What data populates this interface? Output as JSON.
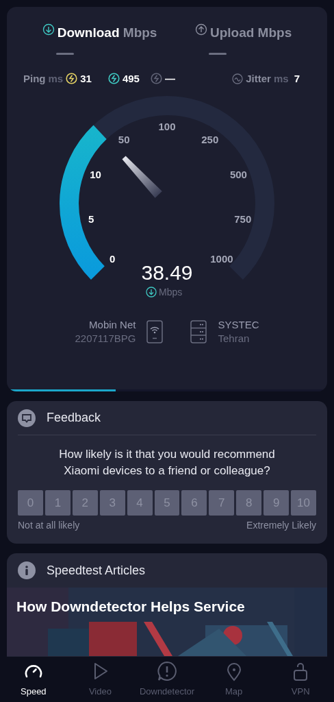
{
  "tabs": [
    {
      "label": "Download",
      "unit": "Mbps",
      "kind": "download",
      "selected": true
    },
    {
      "label": "Upload",
      "unit": "Mbps",
      "kind": "upload",
      "selected": false
    }
  ],
  "ping": {
    "label": "Ping",
    "unit": "ms",
    "readings": [
      {
        "value": "31",
        "color": "#e2d064"
      },
      {
        "value": "495",
        "color": "#3fc8c2"
      },
      {
        "value": "—",
        "color": "#5f6275"
      }
    ]
  },
  "jitter": {
    "label": "Jitter",
    "unit": "ms",
    "value": "7"
  },
  "gauge": {
    "ticks": [
      "0",
      "5",
      "10",
      "50",
      "100",
      "250",
      "500",
      "750",
      "1000"
    ],
    "reading": "38.49",
    "unit": "Mbps"
  },
  "provider": {
    "name": "Mobin Net",
    "detail": "2207117BPG"
  },
  "server": {
    "name": "SYSTEC",
    "detail": "Tehran"
  },
  "progress": {
    "level": 0.34
  },
  "feedback": {
    "title": "Feedback",
    "question": "How likely is it that you would recommend Xiaomi devices to a friend or colleague?",
    "scale": [
      "0",
      "1",
      "2",
      "3",
      "4",
      "5",
      "6",
      "7",
      "8",
      "9",
      "10"
    ],
    "low_label": "Not at all likely",
    "high_label": "Extremely Likely"
  },
  "articles": {
    "title": "Speedtest Articles",
    "items": [
      {
        "title": "How Downdetector Helps Service",
        "kind": "picture"
      }
    ]
  },
  "nav": [
    {
      "label": "Speed",
      "kind": "speed",
      "selected": true
    },
    {
      "label": "Video",
      "kind": "video",
      "selected": false
    },
    {
      "label": "Downdetector",
      "kind": "downdetector",
      "selected": false
    },
    {
      "label": "Map",
      "kind": "map",
      "selected": false
    },
    {
      "label": "VPN",
      "kind": "vpn",
      "selected": false
    }
  ]
}
